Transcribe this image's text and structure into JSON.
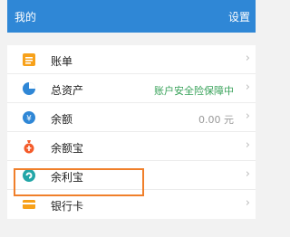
{
  "header": {
    "title": "我的",
    "settings_label": "设置"
  },
  "colors": {
    "header_bg": "#2f87d6",
    "highlight_border": "#f07f2a",
    "safety_green": "#3aa35b"
  },
  "list": {
    "items": [
      {
        "label": "账单",
        "extra": "",
        "icon": "bill-icon",
        "color": "#f7a11a"
      },
      {
        "label": "总资产",
        "extra": "账户安全险保障中",
        "icon": "pie-chart-icon",
        "color": "#2f87d6"
      },
      {
        "label": "余额",
        "extra": "0.00 元",
        "icon": "yuan-circle-icon",
        "color": "#2f87d6"
      },
      {
        "label": "余额宝",
        "extra": "",
        "icon": "money-bag-icon",
        "color": "#f45b2a"
      },
      {
        "label": "余利宝",
        "extra": "",
        "icon": "yulibao-icon",
        "color": "#23a6a8"
      },
      {
        "label": "银行卡",
        "extra": "",
        "icon": "bank-card-icon",
        "color": "#f7a11a"
      }
    ],
    "chevron": "›"
  }
}
